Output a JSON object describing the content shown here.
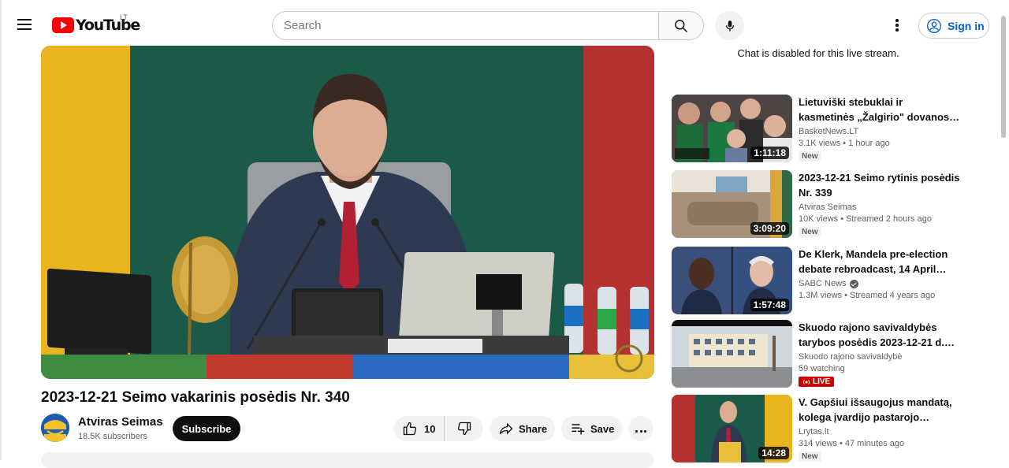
{
  "header": {
    "logo_text": "YouTube",
    "country_code": "LT",
    "search_placeholder": "Search",
    "sign_in_label": "Sign in"
  },
  "video": {
    "title": "2023-12-21 Seimo vakarinis posėdis Nr. 340",
    "channel_name": "Atviras Seimas",
    "subscribers": "18.5K subscribers",
    "subscribe_label": "Subscribe",
    "like_count": "10",
    "share_label": "Share",
    "save_label": "Save"
  },
  "sidebar": {
    "chat_notice": "Chat is disabled for this live stream.",
    "recommendations": [
      {
        "title": "Lietuviški stebuklai ir kasmetinės „Žalgirio\" dovanos…",
        "channel": "BasketNews.LT",
        "verified": false,
        "stats": "3.1K views • 1 hour ago",
        "duration": "1:11:18",
        "badge": "New"
      },
      {
        "title": "2023-12-21 Seimo rytinis posėdis Nr. 339",
        "channel": "Atviras Seimas",
        "verified": false,
        "stats": "10K views • Streamed 2 hours ago",
        "duration": "3:09:20",
        "badge": "New"
      },
      {
        "title": "De Klerk, Mandela pre-election debate rebroadcast, 14 April…",
        "channel": "SABC News",
        "verified": true,
        "stats": "1.3M views • Streamed 4 years ago",
        "duration": "1:57:48",
        "badge": ""
      },
      {
        "title": "Skuodo rajono savivaldybės tarybos posėdis 2023-12-21 d.…",
        "channel": "Skuodo rajono savivaldybė",
        "verified": false,
        "stats": "59 watching",
        "duration": "",
        "badge": "LIVE"
      },
      {
        "title": "V. Gapšiui išsaugojus mandatą, kolega įvardijo pastarojo…",
        "channel": "Lrytas.lt",
        "verified": false,
        "stats": "314 views • 47 minutes ago",
        "duration": "14:28",
        "badge": "New"
      }
    ]
  },
  "colors": {
    "brand_red": "#ff0000",
    "link_blue": "#065fd4",
    "live_red": "#cc0000",
    "flag_yellow": "#e9b41e",
    "flag_green": "#1b5a48",
    "flag_red": "#b3322f"
  }
}
